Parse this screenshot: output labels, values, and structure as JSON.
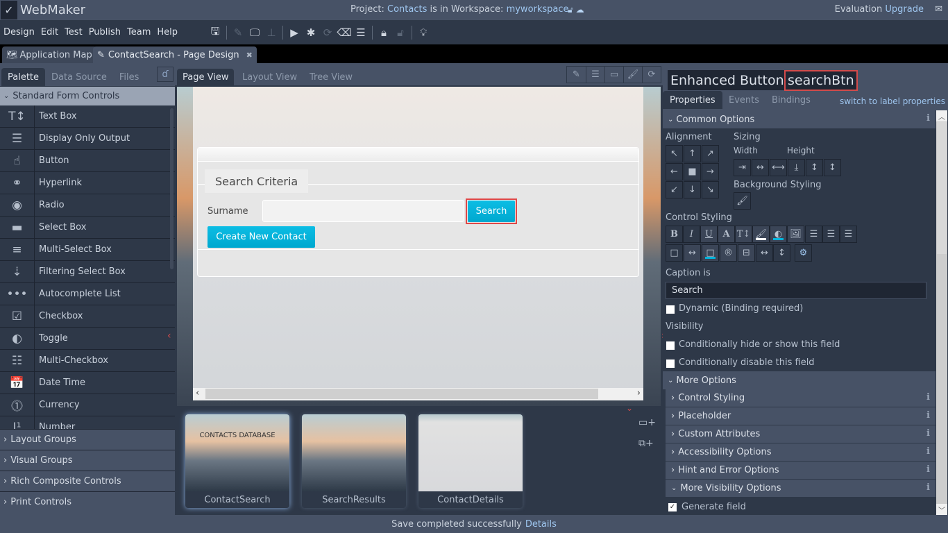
{
  "app": {
    "name": "WebMaker",
    "logo_icon": "checkmark-logo-icon"
  },
  "header": {
    "project_prefix": "Project:",
    "project_name": "Contacts",
    "workspace_prefix": "is in Workspace:",
    "workspace_name": "myworkspace",
    "evaluation": "Evaluation",
    "upgrade": "Upgrade"
  },
  "menu": [
    "Design",
    "Edit",
    "Test",
    "Publish",
    "Team",
    "Help"
  ],
  "toolbar": [
    "save-icon",
    "edit-icon",
    "preview-desktop-icon",
    "sitemap-icon",
    "run-icon",
    "debug-icon",
    "refresh-icon",
    "eraser-icon",
    "server-icon",
    "lock-icon",
    "unlock-icon",
    "lightbulb-icon"
  ],
  "doc_tabs": [
    {
      "label": "Application Map",
      "active": false
    },
    {
      "label": "ContactSearch - Page Design",
      "active": true
    }
  ],
  "left_panel": {
    "tabs": [
      "Palette",
      "Data Source",
      "Files"
    ],
    "section": "Standard Form Controls",
    "items": [
      {
        "label": "Text Box",
        "icon": "T↕"
      },
      {
        "label": "Display Only Output",
        "icon": "☰"
      },
      {
        "label": "Button",
        "icon": "☝"
      },
      {
        "label": "Hyperlink",
        "icon": "⚭"
      },
      {
        "label": "Radio",
        "icon": "◉"
      },
      {
        "label": "Select Box",
        "icon": "▬"
      },
      {
        "label": "Multi-Select Box",
        "icon": "≡"
      },
      {
        "label": "Filtering Select Box",
        "icon": "⇣"
      },
      {
        "label": "Autocomplete List",
        "icon": "•••"
      },
      {
        "label": "Checkbox",
        "icon": "☑"
      },
      {
        "label": "Toggle",
        "icon": "◐"
      },
      {
        "label": "Multi-Checkbox",
        "icon": "☷"
      },
      {
        "label": "Date Time",
        "icon": "📅"
      },
      {
        "label": "Currency",
        "icon": "⓵"
      },
      {
        "label": "Number",
        "icon": "I¹"
      }
    ],
    "groups": [
      "Layout Groups",
      "Visual Groups",
      "Rich Composite Controls",
      "Print Controls"
    ]
  },
  "center": {
    "tabs": [
      "Page View",
      "Layout View",
      "Tree View"
    ],
    "form": {
      "legend": "Search Criteria",
      "surname_label": "Surname",
      "surname_value": "",
      "search_button": "Search",
      "create_button": "Create New Contact"
    },
    "pages": [
      {
        "name": "ContactSearch",
        "caption": "CONTACTS DATABASE",
        "selected": true
      },
      {
        "name": "SearchResults",
        "caption": "",
        "selected": false
      },
      {
        "name": "ContactDetails",
        "caption": "",
        "selected": false
      }
    ]
  },
  "right_panel": {
    "title": "Enhanced Button:",
    "control_name": "searchBtn",
    "tabs": [
      "Properties",
      "Events",
      "Bindings"
    ],
    "switch_link": "switch to label properties",
    "common_options": "Common Options",
    "alignment_label": "Alignment",
    "sizing_label": "Sizing",
    "width_label": "Width",
    "height_label": "Height",
    "background_label": "Background Styling",
    "control_styling_label": "Control Styling",
    "caption_label": "Caption is",
    "caption_value": "Search",
    "dynamic_label": "Dynamic (Binding required)",
    "visibility_label": "Visibility",
    "hide_show_label": "Conditionally hide or show this field",
    "disable_label": "Conditionally disable this field",
    "more_options": "More Options",
    "sub_sections": [
      "Control Styling",
      "Placeholder",
      "Custom Attributes",
      "Accessibility Options",
      "Hint and Error Options",
      "More Visibility Options"
    ],
    "generate_field": "Generate field",
    "checks": {
      "dynamic": false,
      "hide_show": false,
      "disable": false,
      "generate": true
    },
    "colors": {
      "highlight": "#d34b4b",
      "accent": "#00b4dc"
    }
  },
  "status": {
    "message": "Save completed successfully",
    "link": "Details"
  }
}
